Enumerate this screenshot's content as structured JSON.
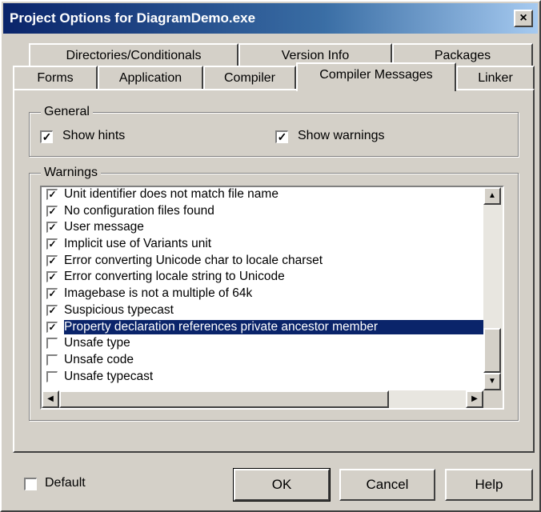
{
  "window": {
    "title": "Project Options for DiagramDemo.exe",
    "close_label": "×"
  },
  "tabs_row1": [
    "Directories/Conditionals",
    "Version Info",
    "Packages"
  ],
  "tabs_row2": [
    "Forms",
    "Application",
    "Compiler",
    "Compiler Messages",
    "Linker"
  ],
  "active_tab": "Compiler Messages",
  "general": {
    "legend": "General",
    "show_hints": {
      "label": "Show hints",
      "checked": true
    },
    "show_warnings": {
      "label": "Show warnings",
      "checked": true
    }
  },
  "warnings": {
    "legend": "Warnings",
    "items": [
      {
        "label": "Unit identifier does not match file name",
        "checked": true
      },
      {
        "label": "No configuration files found",
        "checked": true
      },
      {
        "label": "User message",
        "checked": true
      },
      {
        "label": "Implicit use of Variants unit",
        "checked": true
      },
      {
        "label": "Error converting Unicode char to locale charset",
        "checked": true
      },
      {
        "label": "Error converting locale string to Unicode",
        "checked": true
      },
      {
        "label": "Imagebase is not a multiple of 64k",
        "checked": true
      },
      {
        "label": "Suspicious typecast",
        "checked": true
      },
      {
        "label": "Property declaration references private ancestor member",
        "checked": true,
        "selected": true
      },
      {
        "label": "Unsafe type",
        "checked": false
      },
      {
        "label": "Unsafe code",
        "checked": false
      },
      {
        "label": "Unsafe typecast",
        "checked": false
      }
    ]
  },
  "footer": {
    "default_label": "Default",
    "default_checked": false,
    "ok_label": "OK",
    "cancel_label": "Cancel",
    "help_label": "Help"
  },
  "check_glyph": "✓"
}
